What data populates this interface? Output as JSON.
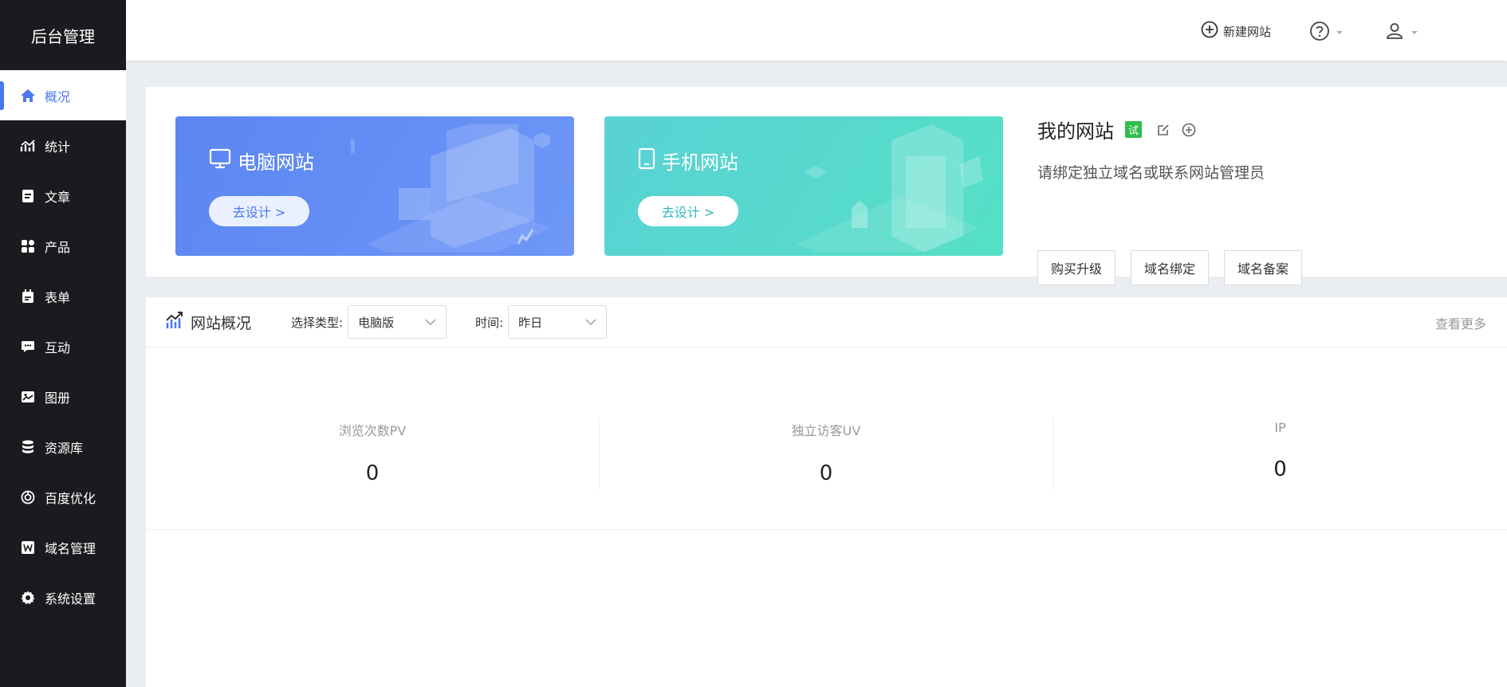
{
  "sidebar": {
    "brand": "后台管理",
    "items": [
      {
        "label": "概况",
        "icon": "home-icon",
        "active": true
      },
      {
        "label": "统计",
        "icon": "chart-icon"
      },
      {
        "label": "文章",
        "icon": "article-icon"
      },
      {
        "label": "产品",
        "icon": "product-icon"
      },
      {
        "label": "表单",
        "icon": "form-icon"
      },
      {
        "label": "互动",
        "icon": "chat-icon"
      },
      {
        "label": "图册",
        "icon": "album-icon"
      },
      {
        "label": "资源库",
        "icon": "database-icon"
      },
      {
        "label": "百度优化",
        "icon": "seo-icon"
      },
      {
        "label": "域名管理",
        "icon": "domain-icon"
      },
      {
        "label": "系统设置",
        "icon": "gear-icon"
      }
    ]
  },
  "topbar": {
    "new_site": "新建网站"
  },
  "site": {
    "pc_title": "电脑网站",
    "pc_btn": "去设计 >",
    "mobile_title": "手机网站",
    "mobile_btn": "去设计 >",
    "my_site_title": "我的网站",
    "trial_badge": "试",
    "desc": "请绑定独立域名或联系网站管理员",
    "buttons": [
      "购买升级",
      "域名绑定",
      "域名备案"
    ]
  },
  "overview": {
    "title": "网站概况",
    "type_label": "选择类型:",
    "type_value": "电脑版",
    "time_label": "时间:",
    "time_value": "昨日",
    "more": "查看更多",
    "stats": [
      {
        "label": "浏览次数PV",
        "value": "0"
      },
      {
        "label": "独立访客UV",
        "value": "0"
      },
      {
        "label": "IP",
        "value": "0"
      }
    ]
  },
  "colors": {
    "accent": "#4a78f0",
    "sidebar_bg": "#1b1b1f",
    "trial_green": "#2fbf4a"
  }
}
